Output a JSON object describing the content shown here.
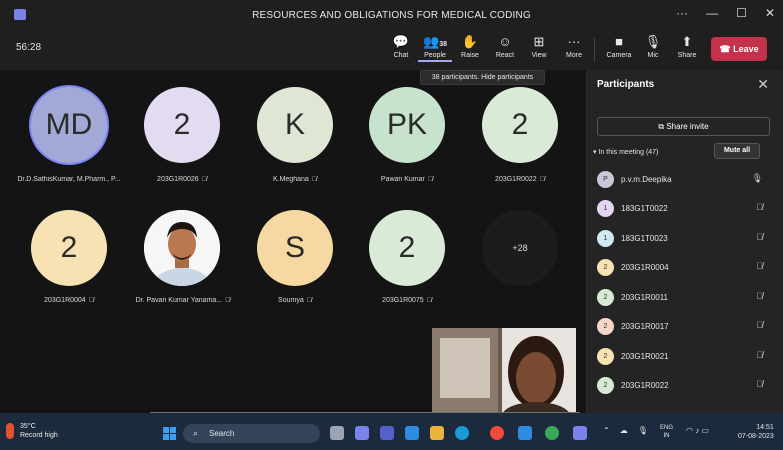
{
  "window": {
    "title": "RESOURCES AND OBLIGATIONS FOR MEDICAL CODING"
  },
  "toolbar": {
    "timer": "56:28",
    "people_count": "38",
    "buttons": [
      {
        "label": "Chat",
        "icon": "chat-icon"
      },
      {
        "label": "People",
        "icon": "people-icon"
      },
      {
        "label": "Raise",
        "icon": "raise-hand-icon"
      },
      {
        "label": "React",
        "icon": "react-icon"
      },
      {
        "label": "View",
        "icon": "view-icon"
      },
      {
        "label": "More",
        "icon": "more-icon"
      },
      {
        "label": "Camera",
        "icon": "camera-icon"
      },
      {
        "label": "Mic",
        "icon": "mic-icon"
      },
      {
        "label": "Share",
        "icon": "share-icon"
      }
    ],
    "leave_label": "Leave",
    "tooltip": "38 participants. Hide participants"
  },
  "stage": {
    "tiles": [
      {
        "initials": "MD",
        "name": "Dr.D.SathisKumar, M.Pharm., P...",
        "color": "#a3a9d6"
      },
      {
        "initials": "2",
        "name": "203G1R0026",
        "color": "#e3dbf0"
      },
      {
        "initials": "K",
        "name": "K.Meghana",
        "color": "#dfe6d4"
      },
      {
        "initials": "PK",
        "name": "Pawan Kumar",
        "color": "#c8e3cd"
      },
      {
        "initials": "2",
        "name": "203G1R0022",
        "color": "#d9ebd7"
      },
      {
        "initials": "2",
        "name": "203G1R0004",
        "color": "#f7e2b4"
      },
      {
        "initials": "",
        "name": "Dr. Pavan Kumar Yanama...",
        "color": "#f6f6f6"
      },
      {
        "initials": "S",
        "name": "Soumya",
        "color": "#f6d9a2"
      },
      {
        "initials": "2",
        "name": "203G1R0075",
        "color": "#d9ebd7"
      },
      {
        "initials": "+28",
        "name": "",
        "color": "#1c1c1c"
      }
    ]
  },
  "panel": {
    "title": "Participants",
    "share_invite": "Share invite",
    "in_meeting": "In this meeting (47)",
    "mute_all": "Mute all",
    "participants": [
      {
        "initial": "P",
        "name": "p.v.m.Deepika",
        "color": "#c8c8d8",
        "mic": "mic-on-icon"
      },
      {
        "initial": "1",
        "name": "183G1T0022",
        "color": "#e3d6f2",
        "mic": "mic-off-icon"
      },
      {
        "initial": "1",
        "name": "183G1T0023",
        "color": "#cfe8f2",
        "mic": "mic-off-icon"
      },
      {
        "initial": "2",
        "name": "203G1R0004",
        "color": "#f7e2b4",
        "mic": "mic-off-icon"
      },
      {
        "initial": "2",
        "name": "203G1R0011",
        "color": "#d6ead2",
        "mic": "mic-off-icon"
      },
      {
        "initial": "2",
        "name": "203G1R0017",
        "color": "#f6d6c8",
        "mic": "mic-off-icon"
      },
      {
        "initial": "2",
        "name": "203G1R0021",
        "color": "#f7e2b4",
        "mic": "mic-off-icon"
      },
      {
        "initial": "2",
        "name": "203G1R0022",
        "color": "#d6ead2",
        "mic": "mic-off-icon"
      }
    ]
  },
  "taskbar": {
    "temperature": "35°C",
    "weather_text": "Record high",
    "search_label": "Search",
    "lang_1": "ENG",
    "lang_2": "IN",
    "time": "14:51",
    "date": "07-08-2023"
  },
  "colors": {
    "accent": "#7f85f5",
    "leave": "#c4314b",
    "panel_bg": "#242424",
    "stage_bg": "#141414"
  }
}
